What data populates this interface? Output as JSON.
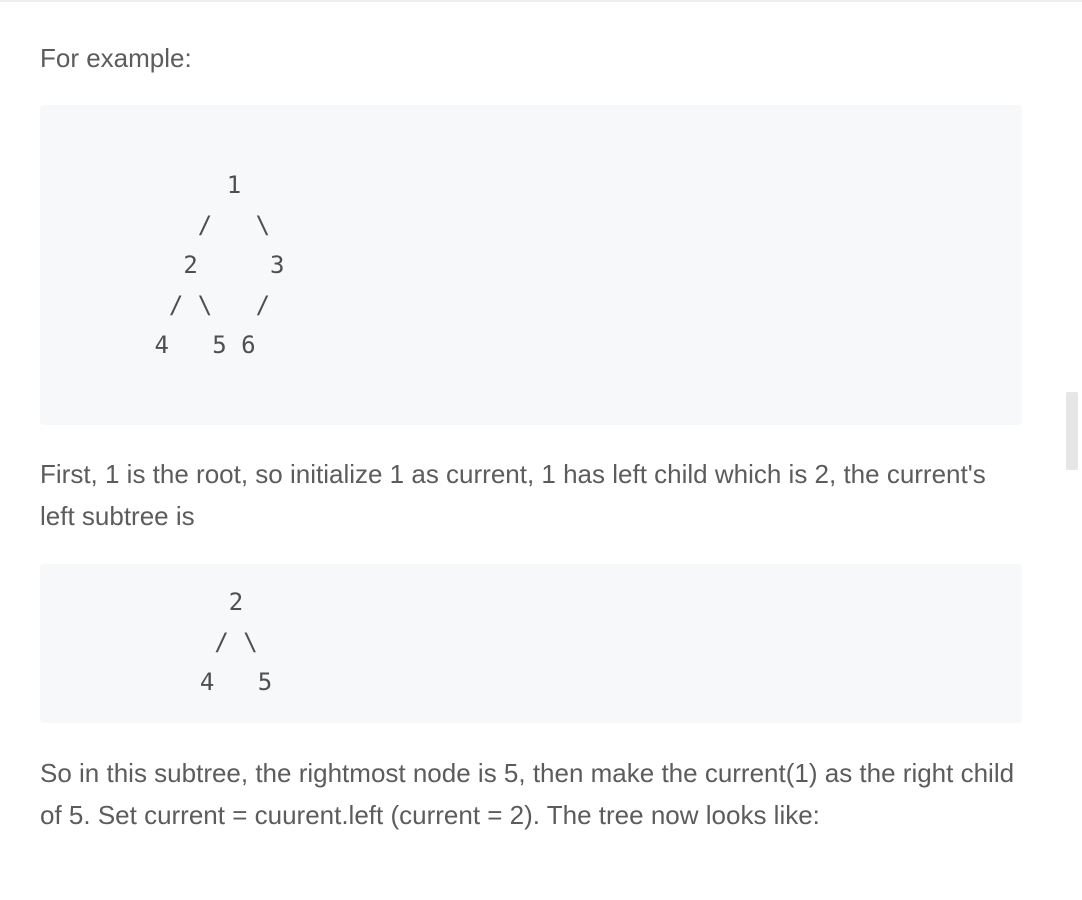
{
  "content": {
    "intro": "For example:",
    "tree_full": {
      "lines": [
        "      1",
        "    /   \\",
        "   2     3",
        "  / \\   /",
        " 4   5 6"
      ]
    },
    "para_first": "First, 1 is the root, so initialize 1 as current, 1 has left child which is 2, the current's left subtree is",
    "tree_subtree": {
      "lines": [
        "    2",
        "   / \\",
        "  4   5"
      ]
    },
    "para_second": "So in this subtree, the rightmost node is 5, then make the current(1) as the right child of 5. Set current = cuurent.left (current = 2). The tree now looks like:"
  }
}
